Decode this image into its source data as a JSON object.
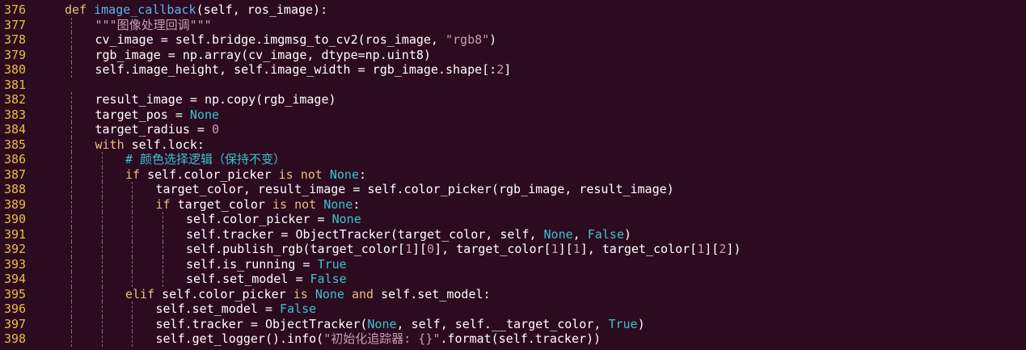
{
  "colors": {
    "background": "#2c0a1f",
    "line_number": "#e6c13c",
    "keyword": "#e5c07b",
    "function_name": "#59b6ec",
    "constant": "#39c5cf",
    "string": "#c89bb8",
    "number": "#c89bb8",
    "comment": "#39c5cf",
    "text": "#ffffff"
  },
  "lines": [
    {
      "number": "376",
      "indent": 0,
      "tokens": [
        [
          "kw",
          "def "
        ],
        [
          "fn",
          "image_callback"
        ],
        [
          "plain",
          "(self, ros_image):"
        ]
      ]
    },
    {
      "number": "377",
      "indent": 1,
      "tokens": [
        [
          "str",
          "\"\"\"图像处理回调\"\"\""
        ]
      ]
    },
    {
      "number": "378",
      "indent": 1,
      "tokens": [
        [
          "plain",
          "cv_image = self.bridge.imgmsg_to_cv2(ros_image, "
        ],
        [
          "str",
          "\"rgb8\""
        ],
        [
          "plain",
          ")"
        ]
      ]
    },
    {
      "number": "379",
      "indent": 1,
      "tokens": [
        [
          "plain",
          "rgb_image = np.array(cv_image, dtype=np.uint8)"
        ]
      ]
    },
    {
      "number": "380",
      "indent": 1,
      "tokens": [
        [
          "plain",
          "self.image_height, self.image_width = rgb_image.shape[:"
        ],
        [
          "num",
          "2"
        ],
        [
          "plain",
          "]"
        ]
      ]
    },
    {
      "number": "381",
      "indent": 0,
      "tokens": []
    },
    {
      "number": "382",
      "indent": 1,
      "tokens": [
        [
          "plain",
          "result_image = np.copy(rgb_image)"
        ]
      ]
    },
    {
      "number": "383",
      "indent": 1,
      "tokens": [
        [
          "plain",
          "target_pos = "
        ],
        [
          "const",
          "None"
        ]
      ]
    },
    {
      "number": "384",
      "indent": 1,
      "tokens": [
        [
          "plain",
          "target_radius = "
        ],
        [
          "num",
          "0"
        ]
      ]
    },
    {
      "number": "385",
      "indent": 1,
      "tokens": [
        [
          "kw",
          "with"
        ],
        [
          "plain",
          " self.lock:"
        ]
      ]
    },
    {
      "number": "386",
      "indent": 2,
      "tokens": [
        [
          "cm",
          "# 颜色选择逻辑（保持不变）"
        ]
      ]
    },
    {
      "number": "387",
      "indent": 2,
      "tokens": [
        [
          "kw",
          "if"
        ],
        [
          "plain",
          " self.color_picker "
        ],
        [
          "kw",
          "is not"
        ],
        [
          "plain",
          " "
        ],
        [
          "const",
          "None"
        ],
        [
          "plain",
          ":"
        ]
      ]
    },
    {
      "number": "388",
      "indent": 3,
      "tokens": [
        [
          "plain",
          "target_color, result_image = self.color_picker(rgb_image, result_image)"
        ]
      ]
    },
    {
      "number": "389",
      "indent": 3,
      "tokens": [
        [
          "kw",
          "if"
        ],
        [
          "plain",
          " target_color "
        ],
        [
          "kw",
          "is not"
        ],
        [
          "plain",
          " "
        ],
        [
          "const",
          "None"
        ],
        [
          "plain",
          ":"
        ]
      ]
    },
    {
      "number": "390",
      "indent": 4,
      "tokens": [
        [
          "plain",
          "self.color_picker = "
        ],
        [
          "const",
          "None"
        ]
      ]
    },
    {
      "number": "391",
      "indent": 4,
      "tokens": [
        [
          "plain",
          "self.tracker = ObjectTracker(target_color, self, "
        ],
        [
          "const",
          "None"
        ],
        [
          "plain",
          ", "
        ],
        [
          "const",
          "False"
        ],
        [
          "plain",
          ")"
        ]
      ]
    },
    {
      "number": "392",
      "indent": 4,
      "tokens": [
        [
          "plain",
          "self.publish_rgb(target_color["
        ],
        [
          "num",
          "1"
        ],
        [
          "plain",
          "]["
        ],
        [
          "num",
          "0"
        ],
        [
          "plain",
          "], target_color["
        ],
        [
          "num",
          "1"
        ],
        [
          "plain",
          "]["
        ],
        [
          "num",
          "1"
        ],
        [
          "plain",
          "], target_color["
        ],
        [
          "num",
          "1"
        ],
        [
          "plain",
          "]["
        ],
        [
          "num",
          "2"
        ],
        [
          "plain",
          "])"
        ]
      ]
    },
    {
      "number": "393",
      "indent": 4,
      "tokens": [
        [
          "plain",
          "self.is_running = "
        ],
        [
          "const",
          "True"
        ]
      ]
    },
    {
      "number": "394",
      "indent": 4,
      "tokens": [
        [
          "plain",
          "self.set_model = "
        ],
        [
          "const",
          "False"
        ]
      ]
    },
    {
      "number": "395",
      "indent": 2,
      "tokens": [
        [
          "kw",
          "elif"
        ],
        [
          "plain",
          " self.color_picker "
        ],
        [
          "kw",
          "is"
        ],
        [
          "plain",
          " "
        ],
        [
          "const",
          "None"
        ],
        [
          "plain",
          " "
        ],
        [
          "kw",
          "and"
        ],
        [
          "plain",
          " self.set_model:"
        ]
      ]
    },
    {
      "number": "396",
      "indent": 3,
      "tokens": [
        [
          "plain",
          "self.set_model = "
        ],
        [
          "const",
          "False"
        ]
      ]
    },
    {
      "number": "397",
      "indent": 3,
      "tokens": [
        [
          "plain",
          "self.tracker = ObjectTracker("
        ],
        [
          "const",
          "None"
        ],
        [
          "plain",
          ", self, self.__target_color, "
        ],
        [
          "const",
          "True"
        ],
        [
          "plain",
          ")"
        ]
      ]
    },
    {
      "number": "398",
      "indent": 3,
      "tokens": [
        [
          "plain",
          "self.get_logger().info("
        ],
        [
          "str",
          "\"初始化追踪器: {}\""
        ],
        [
          "plain",
          ".format(self.tracker))"
        ]
      ]
    }
  ]
}
